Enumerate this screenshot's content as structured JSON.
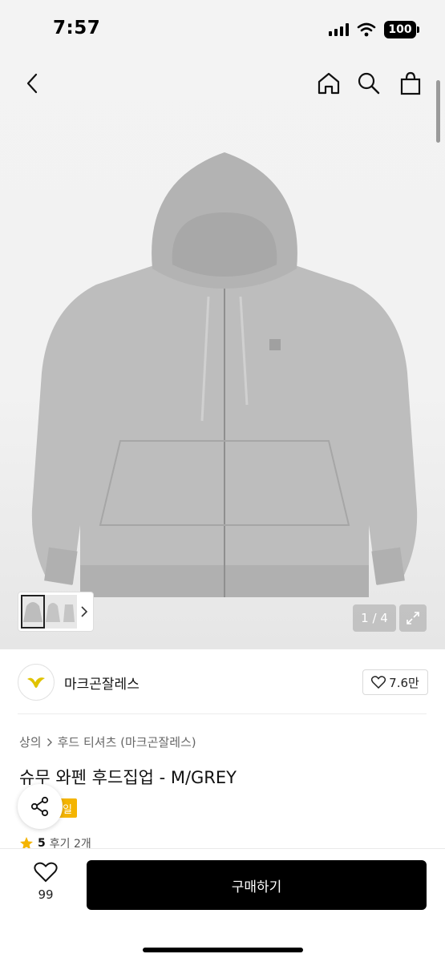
{
  "status_bar": {
    "time": "7:57",
    "battery": "100"
  },
  "nav": {
    "back": "back-icon",
    "home": "home-icon",
    "search": "search-icon",
    "bag": "shopping-bag-icon"
  },
  "gallery": {
    "counter": "1 / 4"
  },
  "store": {
    "name": "마크곤잘레스",
    "likes": "7.6만"
  },
  "breadcrumb": {
    "category": "상의",
    "subcategory": "후드 티셔츠 (마크곤잘레스)"
  },
  "product": {
    "title": "슈무 와펜 후드집업 - M/GREY",
    "badge": "일"
  },
  "rating": {
    "score": "5",
    "reviews": "후기 2개"
  },
  "bottom": {
    "wish_count": "99",
    "buy_label": "구매하기"
  },
  "colors": {
    "accent": "#f4b400",
    "buy": "#000000",
    "hoodie": "#bcbcbc"
  }
}
